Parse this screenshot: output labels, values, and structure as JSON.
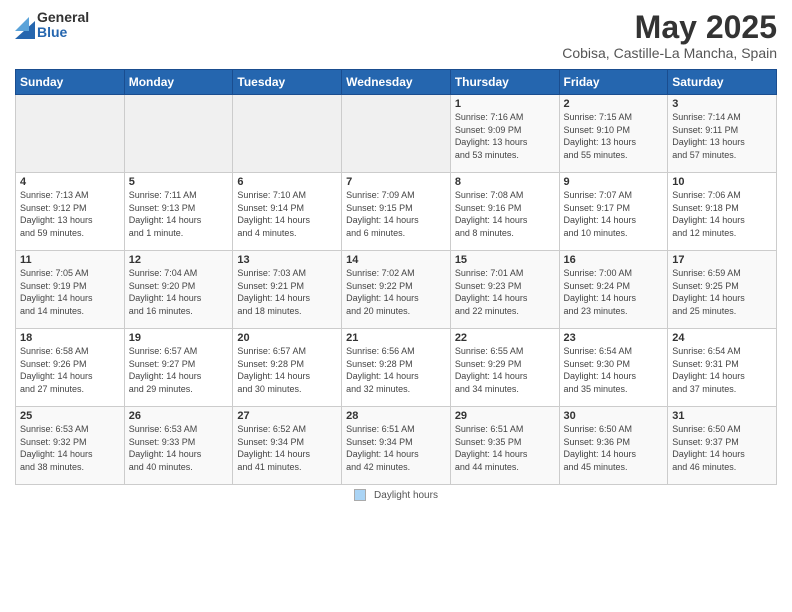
{
  "logo": {
    "general": "General",
    "blue": "Blue"
  },
  "title": "May 2025",
  "subtitle": "Cobisa, Castille-La Mancha, Spain",
  "headers": [
    "Sunday",
    "Monday",
    "Tuesday",
    "Wednesday",
    "Thursday",
    "Friday",
    "Saturday"
  ],
  "weeks": [
    [
      {
        "num": "",
        "info": ""
      },
      {
        "num": "",
        "info": ""
      },
      {
        "num": "",
        "info": ""
      },
      {
        "num": "",
        "info": ""
      },
      {
        "num": "1",
        "info": "Sunrise: 7:16 AM\nSunset: 9:09 PM\nDaylight: 13 hours\nand 53 minutes."
      },
      {
        "num": "2",
        "info": "Sunrise: 7:15 AM\nSunset: 9:10 PM\nDaylight: 13 hours\nand 55 minutes."
      },
      {
        "num": "3",
        "info": "Sunrise: 7:14 AM\nSunset: 9:11 PM\nDaylight: 13 hours\nand 57 minutes."
      }
    ],
    [
      {
        "num": "4",
        "info": "Sunrise: 7:13 AM\nSunset: 9:12 PM\nDaylight: 13 hours\nand 59 minutes."
      },
      {
        "num": "5",
        "info": "Sunrise: 7:11 AM\nSunset: 9:13 PM\nDaylight: 14 hours\nand 1 minute."
      },
      {
        "num": "6",
        "info": "Sunrise: 7:10 AM\nSunset: 9:14 PM\nDaylight: 14 hours\nand 4 minutes."
      },
      {
        "num": "7",
        "info": "Sunrise: 7:09 AM\nSunset: 9:15 PM\nDaylight: 14 hours\nand 6 minutes."
      },
      {
        "num": "8",
        "info": "Sunrise: 7:08 AM\nSunset: 9:16 PM\nDaylight: 14 hours\nand 8 minutes."
      },
      {
        "num": "9",
        "info": "Sunrise: 7:07 AM\nSunset: 9:17 PM\nDaylight: 14 hours\nand 10 minutes."
      },
      {
        "num": "10",
        "info": "Sunrise: 7:06 AM\nSunset: 9:18 PM\nDaylight: 14 hours\nand 12 minutes."
      }
    ],
    [
      {
        "num": "11",
        "info": "Sunrise: 7:05 AM\nSunset: 9:19 PM\nDaylight: 14 hours\nand 14 minutes."
      },
      {
        "num": "12",
        "info": "Sunrise: 7:04 AM\nSunset: 9:20 PM\nDaylight: 14 hours\nand 16 minutes."
      },
      {
        "num": "13",
        "info": "Sunrise: 7:03 AM\nSunset: 9:21 PM\nDaylight: 14 hours\nand 18 minutes."
      },
      {
        "num": "14",
        "info": "Sunrise: 7:02 AM\nSunset: 9:22 PM\nDaylight: 14 hours\nand 20 minutes."
      },
      {
        "num": "15",
        "info": "Sunrise: 7:01 AM\nSunset: 9:23 PM\nDaylight: 14 hours\nand 22 minutes."
      },
      {
        "num": "16",
        "info": "Sunrise: 7:00 AM\nSunset: 9:24 PM\nDaylight: 14 hours\nand 23 minutes."
      },
      {
        "num": "17",
        "info": "Sunrise: 6:59 AM\nSunset: 9:25 PM\nDaylight: 14 hours\nand 25 minutes."
      }
    ],
    [
      {
        "num": "18",
        "info": "Sunrise: 6:58 AM\nSunset: 9:26 PM\nDaylight: 14 hours\nand 27 minutes."
      },
      {
        "num": "19",
        "info": "Sunrise: 6:57 AM\nSunset: 9:27 PM\nDaylight: 14 hours\nand 29 minutes."
      },
      {
        "num": "20",
        "info": "Sunrise: 6:57 AM\nSunset: 9:28 PM\nDaylight: 14 hours\nand 30 minutes."
      },
      {
        "num": "21",
        "info": "Sunrise: 6:56 AM\nSunset: 9:28 PM\nDaylight: 14 hours\nand 32 minutes."
      },
      {
        "num": "22",
        "info": "Sunrise: 6:55 AM\nSunset: 9:29 PM\nDaylight: 14 hours\nand 34 minutes."
      },
      {
        "num": "23",
        "info": "Sunrise: 6:54 AM\nSunset: 9:30 PM\nDaylight: 14 hours\nand 35 minutes."
      },
      {
        "num": "24",
        "info": "Sunrise: 6:54 AM\nSunset: 9:31 PM\nDaylight: 14 hours\nand 37 minutes."
      }
    ],
    [
      {
        "num": "25",
        "info": "Sunrise: 6:53 AM\nSunset: 9:32 PM\nDaylight: 14 hours\nand 38 minutes."
      },
      {
        "num": "26",
        "info": "Sunrise: 6:53 AM\nSunset: 9:33 PM\nDaylight: 14 hours\nand 40 minutes."
      },
      {
        "num": "27",
        "info": "Sunrise: 6:52 AM\nSunset: 9:34 PM\nDaylight: 14 hours\nand 41 minutes."
      },
      {
        "num": "28",
        "info": "Sunrise: 6:51 AM\nSunset: 9:34 PM\nDaylight: 14 hours\nand 42 minutes."
      },
      {
        "num": "29",
        "info": "Sunrise: 6:51 AM\nSunset: 9:35 PM\nDaylight: 14 hours\nand 44 minutes."
      },
      {
        "num": "30",
        "info": "Sunrise: 6:50 AM\nSunset: 9:36 PM\nDaylight: 14 hours\nand 45 minutes."
      },
      {
        "num": "31",
        "info": "Sunrise: 6:50 AM\nSunset: 9:37 PM\nDaylight: 14 hours\nand 46 minutes."
      }
    ]
  ],
  "footer": {
    "swatch_label": "Daylight hours"
  }
}
